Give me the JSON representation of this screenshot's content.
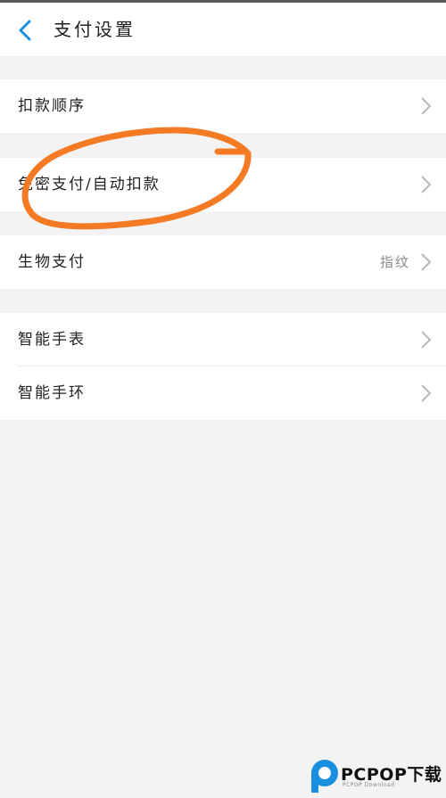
{
  "header": {
    "title": "支付设置",
    "back_icon": "chevron-left-icon",
    "accent_color": "#1a8fe0"
  },
  "groups": [
    {
      "rows": [
        {
          "label": "扣款顺序",
          "value": ""
        }
      ]
    },
    {
      "rows": [
        {
          "label": "免密支付/自动扣款",
          "value": ""
        }
      ]
    },
    {
      "rows": [
        {
          "label": "生物支付",
          "value": "指纹"
        }
      ]
    },
    {
      "rows": [
        {
          "label": "智能手表",
          "value": ""
        },
        {
          "label": "智能手环",
          "value": ""
        }
      ]
    }
  ],
  "annotation": {
    "color": "#f47a24"
  },
  "watermark": {
    "text": "PCPOP下载",
    "sub": "PCPOP Download",
    "color": "#1a8fe0"
  }
}
